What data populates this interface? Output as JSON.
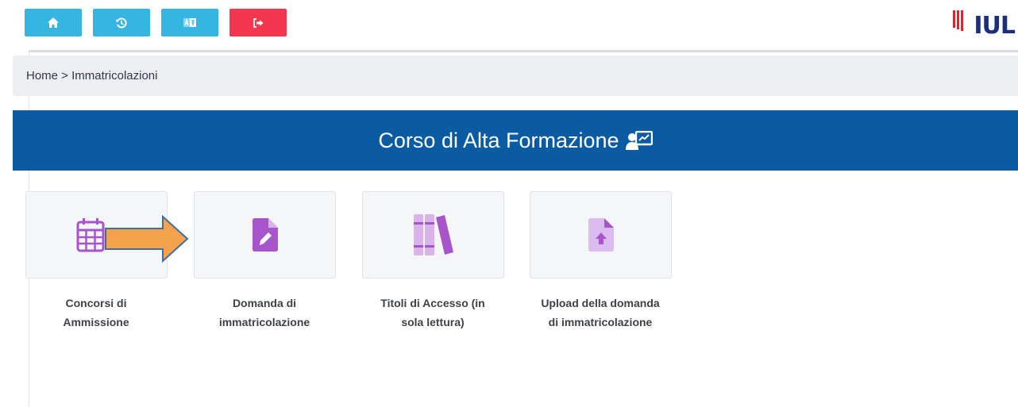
{
  "toolbar": {
    "buttons": [
      {
        "name": "home-button",
        "icon": "home-icon",
        "color": "#35b6e0"
      },
      {
        "name": "history-button",
        "icon": "history-icon",
        "color": "#35b6e0"
      },
      {
        "name": "language-button",
        "icon": "translate-icon",
        "color": "#35b6e0"
      },
      {
        "name": "logout-button",
        "icon": "logout-icon",
        "color": "#f2374f"
      }
    ]
  },
  "logo": {
    "text": "IUL"
  },
  "breadcrumb": {
    "home": "Home",
    "separator": " > ",
    "current": "Immatricolazioni"
  },
  "banner": {
    "title": "Corso di Alta Formazione",
    "icon": "presentation-icon",
    "color": "#0a5ba1"
  },
  "tiles": [
    {
      "label_line1": "Concorsi di",
      "label_line2": "Ammissione",
      "icon": "calendar-icon"
    },
    {
      "label_line1": "Domanda di",
      "label_line2": "immatricolazione",
      "icon": "file-edit-icon"
    },
    {
      "label_line1": "Titoli di Accesso (in",
      "label_line2": "sola lettura)",
      "icon": "books-icon"
    },
    {
      "label_line1": "Upload della domanda",
      "label_line2": "di immatricolazione",
      "icon": "file-upload-icon"
    }
  ],
  "accent": {
    "icon_purple": "#a855cc",
    "arrow_orange": "#f4a34c"
  }
}
